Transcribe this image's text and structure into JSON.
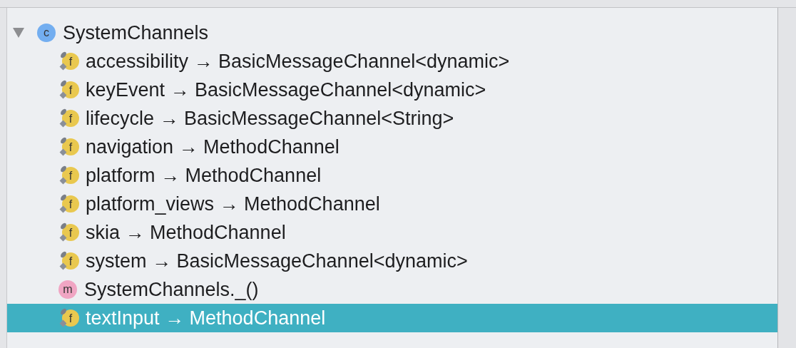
{
  "tree": {
    "label": "SystemChannels",
    "kind": "class",
    "icon_letter": "c",
    "expanded": true,
    "selected": false,
    "children": [
      {
        "label": "accessibility → BasicMessageChannel<dynamic>",
        "kind": "field",
        "icon_letter": "f",
        "selected": false
      },
      {
        "label": "keyEvent → BasicMessageChannel<dynamic>",
        "kind": "field",
        "icon_letter": "f",
        "selected": false
      },
      {
        "label": "lifecycle → BasicMessageChannel<String>",
        "kind": "field",
        "icon_letter": "f",
        "selected": false
      },
      {
        "label": "navigation → MethodChannel",
        "kind": "field",
        "icon_letter": "f",
        "selected": false
      },
      {
        "label": "platform → MethodChannel",
        "kind": "field",
        "icon_letter": "f",
        "selected": false
      },
      {
        "label": "platform_views → MethodChannel",
        "kind": "field",
        "icon_letter": "f",
        "selected": false
      },
      {
        "label": "skia → MethodChannel",
        "kind": "field",
        "icon_letter": "f",
        "selected": false
      },
      {
        "label": "system → BasicMessageChannel<dynamic>",
        "kind": "field",
        "icon_letter": "f",
        "selected": false
      },
      {
        "label": "SystemChannels._()",
        "kind": "method",
        "icon_letter": "m",
        "selected": false
      },
      {
        "label": "textInput → MethodChannel",
        "kind": "field",
        "icon_letter": "f",
        "selected": true
      }
    ]
  }
}
